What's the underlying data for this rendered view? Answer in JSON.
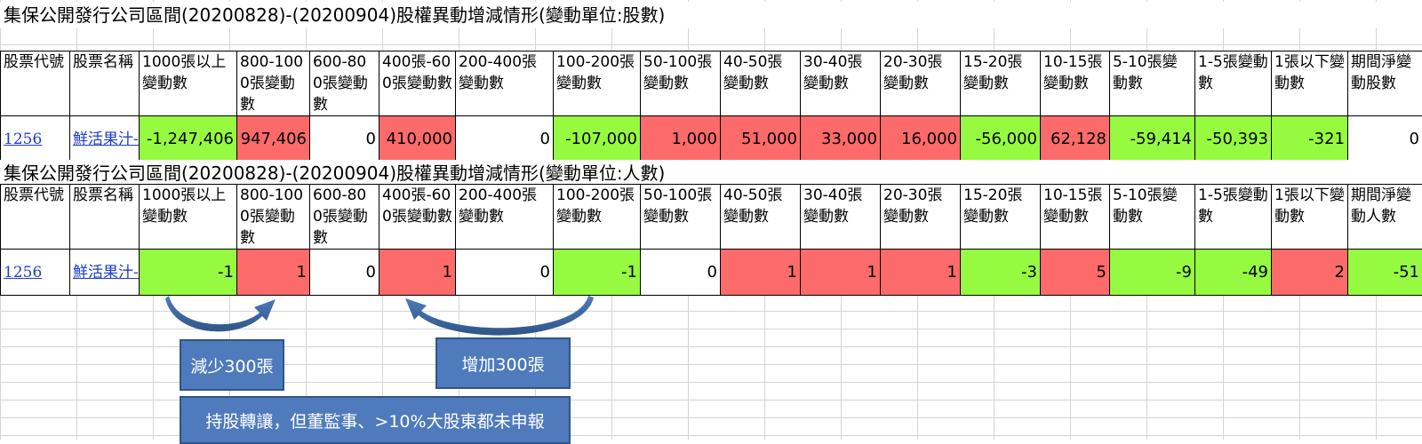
{
  "colors": {
    "increase": "#fd6a6a",
    "decrease": "#96fb40",
    "box": "#4f7bbd",
    "link": "#1f3cd2"
  },
  "headers": [
    "股票代號",
    "股票名稱",
    "1000張以上變動數",
    "800-1000張變動數",
    "600-800張變動數",
    "400張-600張變動數",
    "200-400張變動數",
    "100-200張變動數",
    "50-100張變動數",
    "40-50張變動數",
    "30-40張變動數",
    "20-30張變動數",
    "15-20張變動數",
    "10-15張變動數",
    "5-10張變動數",
    "1-5張變動數",
    "1張以下變動數"
  ],
  "table1": {
    "title": "集保公開發行公司區間(20200828)-(20200904)股權異動增減情形(變動單位:股數)",
    "last_header": "期間淨變動股數",
    "row": {
      "code": "1256",
      "name": "鮮活果汁-KY",
      "values": [
        "-1,247,406",
        "947,406",
        "0",
        "410,000",
        "0",
        "-107,000",
        "1,000",
        "51,000",
        "33,000",
        "16,000",
        "-56,000",
        "62,128",
        "-59,414",
        "-50,393",
        "-321",
        "0"
      ],
      "colors": [
        "green",
        "red",
        "white",
        "red",
        "white",
        "green",
        "red",
        "red",
        "red",
        "red",
        "green",
        "red",
        "green",
        "green",
        "green",
        "white"
      ]
    }
  },
  "table2": {
    "title": "集保公開發行公司區間(20200828)-(20200904)股權異動增減情形(變動單位:人數)",
    "last_header": "期間淨變動人數",
    "row": {
      "code": "1256",
      "name": "鮮活果汁-KY",
      "values": [
        "-1",
        "1",
        "0",
        "1",
        "0",
        "-1",
        "0",
        "1",
        "1",
        "1",
        "-3",
        "5",
        "-9",
        "-49",
        "2",
        "-51"
      ],
      "colors": [
        "green",
        "red",
        "white",
        "red",
        "white",
        "green",
        "white",
        "red",
        "red",
        "red",
        "green",
        "red",
        "green",
        "green",
        "red",
        "green"
      ]
    }
  },
  "notes": {
    "decrease": "減少300張",
    "increase": "增加300張",
    "summary": "持股轉讓，但董監事、>10%大股東都未申報"
  }
}
